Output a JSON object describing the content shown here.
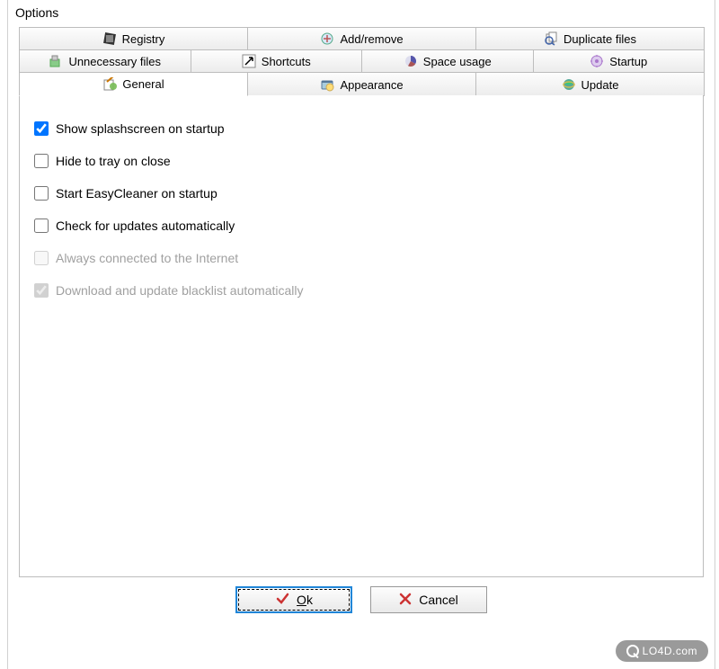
{
  "window": {
    "title": "Options"
  },
  "tabs": {
    "row1": [
      {
        "icon": "registry-icon",
        "label": "Registry"
      },
      {
        "icon": "addremove-icon",
        "label": "Add/remove"
      },
      {
        "icon": "duplicate-icon",
        "label": "Duplicate files"
      }
    ],
    "row2": [
      {
        "icon": "unnecessary-icon",
        "label": "Unnecessary files"
      },
      {
        "icon": "shortcut-icon",
        "label": "Shortcuts"
      },
      {
        "icon": "space-icon",
        "label": "Space usage"
      },
      {
        "icon": "startup-icon",
        "label": "Startup"
      }
    ],
    "row3": [
      {
        "icon": "general-icon",
        "label": "General",
        "active": true
      },
      {
        "icon": "appearance-icon",
        "label": "Appearance"
      },
      {
        "icon": "update-icon",
        "label": "Update"
      }
    ]
  },
  "options": [
    {
      "label": "Show splashscreen on startup",
      "checked": true,
      "disabled": false
    },
    {
      "label": "Hide to tray on close",
      "checked": false,
      "disabled": false
    },
    {
      "label": "Start EasyCleaner on startup",
      "checked": false,
      "disabled": false
    },
    {
      "label": "Check for updates automatically",
      "checked": false,
      "disabled": false
    },
    {
      "label": "Always connected to the Internet",
      "checked": false,
      "disabled": true
    },
    {
      "label": "Download and update blacklist automatically",
      "checked": true,
      "disabled": true
    }
  ],
  "buttons": {
    "ok": {
      "prefix": "O",
      "rest": "k"
    },
    "cancel": {
      "label": "Cancel"
    }
  },
  "watermark": "LO4D.com"
}
